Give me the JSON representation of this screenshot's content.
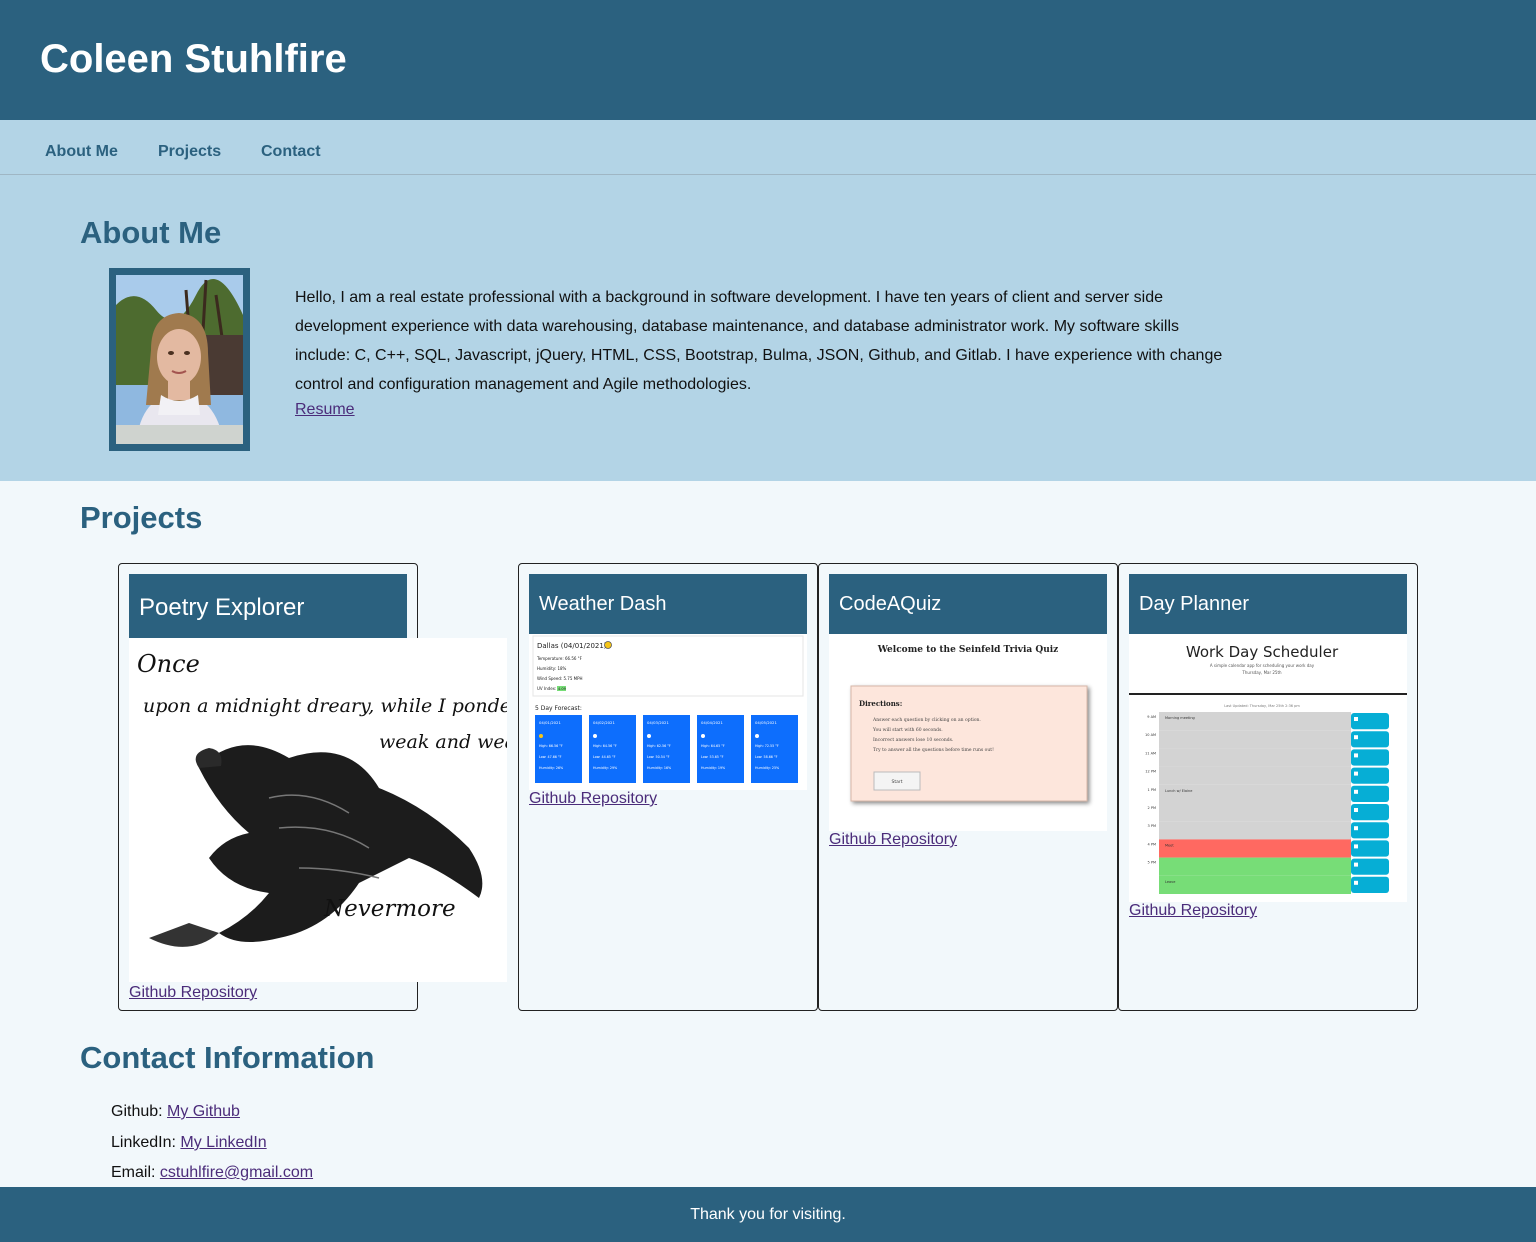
{
  "header": {
    "title": "Coleen Stuhlfire"
  },
  "nav": {
    "items": [
      "About Me",
      "Projects",
      "Contact"
    ]
  },
  "about": {
    "title": "About Me",
    "bio": "Hello, I am a real estate professional with a background in software development. I have ten years of client and server side development experience with data warehousing, database maintenance, and database administrator work. My software skills include: C, C++, SQL, Javascript, jQuery, HTML, CSS, Bootstrap, Bulma, JSON, Github, and Gitlab. I have experience with change control and configuration management and Agile methodologies.",
    "resume_label": "Resume"
  },
  "projects": {
    "title": "Projects",
    "cards": [
      {
        "title": "Poetry Explorer",
        "link": "Github Repository",
        "image_text": {
          "line1": "Once",
          "line2": "upon a midnight dreary, while I pondered,",
          "line3": "weak and weary.",
          "line4": "Nevermore"
        }
      },
      {
        "title": "Weather Dash",
        "link": "Github Repository",
        "image_text": {
          "city": "Dallas (04/01/2021)",
          "temp": "Temperature: 66.56 °F",
          "humidity": "Humidity: 18%",
          "wind": "Wind Speed: 5.75 MPH",
          "uv": "UV Index: ",
          "uv_value": "4.09",
          "forecast_title": "5 Day Forecast:",
          "days": [
            "04/01/2021",
            "04/02/2021",
            "04/03/2021",
            "04/04/2021",
            "04/05/2021"
          ],
          "highs": [
            "High: 66.56 °F",
            "High: 64.56 °F",
            "High: 62.56 °F",
            "High: 64.65 °F",
            "High: 72.55 °F"
          ],
          "lows": [
            "Low: 47.66 °F",
            "Low: 44.65 °F",
            "Low: 50.54 °F",
            "Low: 53.65 °F",
            "Low: 58.66 °F"
          ],
          "hums": [
            "Humidity: 26%",
            "Humidity: 29%",
            "Humidity: 16%",
            "Humidity: 19%",
            "Humidity: 25%"
          ]
        }
      },
      {
        "title": "CodeAQuiz",
        "link": "Github Repository",
        "image_text": {
          "heading": "Welcome to the Seinfeld Trivia Quiz",
          "directions": "Directions:",
          "lines": [
            "Answer each question by clicking on an option.",
            "You will start with 60 seconds.",
            "Incorrect answers lose 10 seconds.",
            "Try to answer all the questions before time runs out!"
          ],
          "start": "Start"
        }
      },
      {
        "title": "Day Planner",
        "link": "Github Repository",
        "image_text": {
          "heading": "Work Day Scheduler",
          "sub": "A simple calendar app for scheduling your work day",
          "date": "Thursday, Mar 25th",
          "updated": "Last Updated: Thursday, Mar 25th 2:36 pm",
          "hours": [
            "9 AM",
            "10 AM",
            "11 AM",
            "12 PM",
            "1 PM",
            "2 PM",
            "3 PM",
            "4 PM",
            "5 PM"
          ],
          "events": [
            "Morning meeting",
            "",
            "",
            "",
            "",
            "Lunch w/ Elaine",
            "",
            "",
            "",
            "",
            "Meet",
            "",
            "",
            "",
            "Leave"
          ]
        }
      }
    ]
  },
  "contact": {
    "title": "Contact Information",
    "github_label": "Github: ",
    "github_link": "My Github",
    "linkedin_label": "LinkedIn: ",
    "linkedin_link": "My LinkedIn",
    "email_label": "Email: ",
    "email_link": "cstuhlfire@gmail.com"
  },
  "footer": {
    "text": "Thank you for visiting."
  },
  "colors": {
    "primary": "#2b617f",
    "light": "#b3d4e6",
    "background": "#f2f8fb",
    "link": "#4b2c7a",
    "weather_blue": "#0d6efd",
    "planner_past": "#d3d3d3",
    "planner_present": "#ff6961",
    "planner_future": "#77dd77",
    "planner_save": "#06aed5"
  }
}
